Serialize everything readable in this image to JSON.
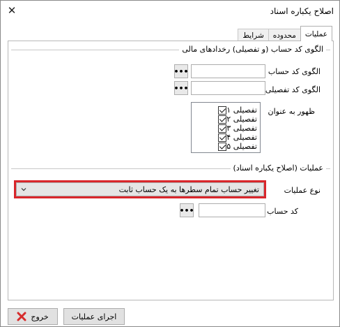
{
  "window": {
    "title": "اصلاح یکباره اسناد",
    "close_glyph": "✕"
  },
  "tabs": [
    {
      "label": "عملیات",
      "active": true
    },
    {
      "label": "محدوده",
      "active": false
    },
    {
      "label": "شرایط",
      "active": false
    }
  ],
  "account_pattern_group": {
    "legend": "الگوی کد حساب (و تفصیلی) رخدادهای مالی",
    "account_code_label": "الگوی کد حساب",
    "account_code_value": "",
    "detail_code_label": "الگوی کد تفصیلی",
    "detail_code_value": "",
    "ellipsis": "•••",
    "show_as_label": "ظهور به عنوان",
    "show_as_items": [
      {
        "label": "تفصیلی ۱",
        "checked": true
      },
      {
        "label": "تفصیلی ۲",
        "checked": true
      },
      {
        "label": "تفصیلی ۳",
        "checked": true
      },
      {
        "label": "تفصیلی ۴",
        "checked": true
      },
      {
        "label": "تفصیلی ۵",
        "checked": true
      }
    ]
  },
  "operation_group": {
    "legend": "عملیات (اصلاح یکباره اسناد)",
    "op_type_label": "نوع عملیات",
    "op_type_value": "تغییر حساب تمام سطرها به یک حساب ثابت",
    "account_code_label": "کد حساب",
    "account_code_value": "",
    "ellipsis": "•••"
  },
  "footer": {
    "run_label": "اجرای عملیات",
    "exit_label": "خروج"
  },
  "colors": {
    "highlight_border": "#d9262b",
    "exit_icon": "#d62b2b"
  }
}
